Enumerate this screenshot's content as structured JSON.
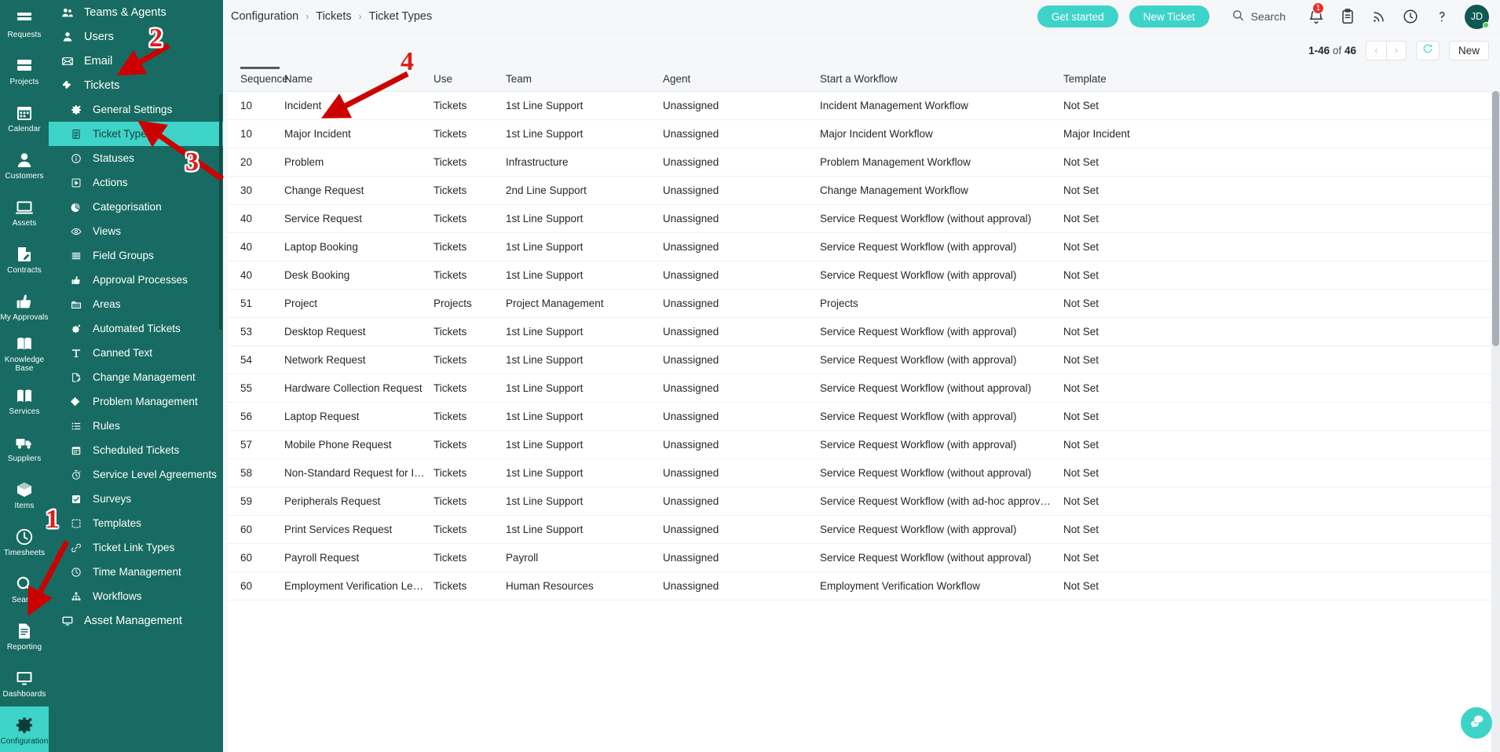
{
  "rail": {
    "items": [
      {
        "label": "Requests",
        "icon": "requests-icon",
        "active": false
      },
      {
        "label": "Projects",
        "icon": "projects-icon",
        "active": false
      },
      {
        "label": "Calendar",
        "icon": "calendar-icon",
        "active": false
      },
      {
        "label": "Customers",
        "icon": "customers-icon",
        "active": false
      },
      {
        "label": "Assets",
        "icon": "assets-icon",
        "active": false
      },
      {
        "label": "Contracts",
        "icon": "contracts-icon",
        "active": false
      },
      {
        "label": "My Approvals",
        "icon": "approvals-icon",
        "active": false
      },
      {
        "label": "Knowledge Base",
        "icon": "knowledge-base-icon",
        "active": false
      },
      {
        "label": "Services",
        "icon": "services-icon",
        "active": false
      },
      {
        "label": "Suppliers",
        "icon": "suppliers-icon",
        "active": false
      },
      {
        "label": "Items",
        "icon": "items-icon",
        "active": false
      },
      {
        "label": "Timesheets",
        "icon": "timesheets-icon",
        "active": false
      },
      {
        "label": "Search",
        "icon": "search-icon",
        "active": false
      },
      {
        "label": "Reporting",
        "icon": "reporting-icon",
        "active": false
      },
      {
        "label": "Dashboards",
        "icon": "dashboards-icon",
        "active": false
      },
      {
        "label": "Configuration",
        "icon": "gear-icon",
        "active": true
      }
    ]
  },
  "confnav": {
    "items": [
      {
        "label": "Teams & Agents",
        "icon": "teams-icon",
        "level": "top",
        "active": false
      },
      {
        "label": "Users",
        "icon": "user-icon",
        "level": "top",
        "active": false
      },
      {
        "label": "Email",
        "icon": "email-icon",
        "level": "top",
        "active": false
      },
      {
        "label": "Tickets",
        "icon": "ticket-icon",
        "level": "top",
        "active": false
      },
      {
        "label": "General Settings",
        "icon": "gear-icon",
        "level": "sub",
        "active": false
      },
      {
        "label": "Ticket Types",
        "icon": "list-doc-icon",
        "level": "sub",
        "active": true
      },
      {
        "label": "Statuses",
        "icon": "info-icon",
        "level": "sub",
        "active": false
      },
      {
        "label": "Actions",
        "icon": "play-box-icon",
        "level": "sub",
        "active": false
      },
      {
        "label": "Categorisation",
        "icon": "pie-icon",
        "level": "sub",
        "active": false
      },
      {
        "label": "Views",
        "icon": "eye-icon",
        "level": "sub",
        "active": false
      },
      {
        "label": "Field Groups",
        "icon": "lines-icon",
        "level": "sub",
        "active": false
      },
      {
        "label": "Approval Processes",
        "icon": "thumbs-up-icon",
        "level": "sub",
        "active": false
      },
      {
        "label": "Areas",
        "icon": "folder-icon",
        "level": "sub",
        "active": false
      },
      {
        "label": "Automated Tickets",
        "icon": "gear-auto-icon",
        "level": "sub",
        "active": false
      },
      {
        "label": "Canned Text",
        "icon": "text-t-icon",
        "level": "sub",
        "active": false
      },
      {
        "label": "Change Management",
        "icon": "edit-doc-icon",
        "level": "sub",
        "active": false
      },
      {
        "label": "Problem Management",
        "icon": "puzzle-icon",
        "level": "sub",
        "active": false
      },
      {
        "label": "Rules",
        "icon": "bullet-list-icon",
        "level": "sub",
        "active": false
      },
      {
        "label": "Scheduled Tickets",
        "icon": "calendar-icon",
        "level": "sub",
        "active": false
      },
      {
        "label": "Service Level Agreements",
        "icon": "stopwatch-icon",
        "level": "sub",
        "active": false
      },
      {
        "label": "Surveys",
        "icon": "checkbox-icon",
        "level": "sub",
        "active": false
      },
      {
        "label": "Templates",
        "icon": "dashed-box-icon",
        "level": "sub",
        "active": false
      },
      {
        "label": "Ticket Link Types",
        "icon": "link-icon",
        "level": "sub",
        "active": false
      },
      {
        "label": "Time Management",
        "icon": "clock-icon",
        "level": "sub",
        "active": false
      },
      {
        "label": "Workflows",
        "icon": "hierarchy-icon",
        "level": "sub",
        "active": false
      },
      {
        "label": "Asset Management",
        "icon": "monitor-icon",
        "level": "top",
        "active": false
      }
    ]
  },
  "header": {
    "breadcrumb": [
      "Configuration",
      "Tickets",
      "Ticket Types"
    ],
    "get_started_label": "Get started",
    "new_ticket_label": "New Ticket",
    "search_label": "Search",
    "notification_count": "1",
    "avatar_initials": "JD"
  },
  "toolbar": {
    "page_info_range": "1-46",
    "page_info_of": "of",
    "page_info_total": "46",
    "prev_label": "‹",
    "next_label": "›",
    "new_label": "New"
  },
  "table": {
    "columns": [
      "Sequence",
      "Name",
      "Use",
      "Team",
      "Agent",
      "Start a Workflow",
      "Template"
    ],
    "rows": [
      [
        "10",
        "Incident",
        "Tickets",
        "1st Line Support",
        "Unassigned",
        "Incident Management Workflow",
        "Not Set"
      ],
      [
        "10",
        "Major Incident",
        "Tickets",
        "1st Line Support",
        "Unassigned",
        "Major Incident Workflow",
        "Major Incident"
      ],
      [
        "20",
        "Problem",
        "Tickets",
        "Infrastructure",
        "Unassigned",
        "Problem Management Workflow",
        "Not Set"
      ],
      [
        "30",
        "Change Request",
        "Tickets",
        "2nd Line Support",
        "Unassigned",
        "Change Management Workflow",
        "Not Set"
      ],
      [
        "40",
        "Service Request",
        "Tickets",
        "1st Line Support",
        "Unassigned",
        "Service Request Workflow (without approval)",
        "Not Set"
      ],
      [
        "40",
        "Laptop Booking",
        "Tickets",
        "1st Line Support",
        "Unassigned",
        "Service Request Workflow (with approval)",
        "Not Set"
      ],
      [
        "40",
        "Desk Booking",
        "Tickets",
        "1st Line Support",
        "Unassigned",
        "Service Request Workflow (with approval)",
        "Not Set"
      ],
      [
        "51",
        "Project",
        "Projects",
        "Project Management",
        "Unassigned",
        "Projects",
        "Not Set"
      ],
      [
        "53",
        "Desktop Request",
        "Tickets",
        "1st Line Support",
        "Unassigned",
        "Service Request Workflow (with approval)",
        "Not Set"
      ],
      [
        "54",
        "Network Request",
        "Tickets",
        "1st Line Support",
        "Unassigned",
        "Service Request Workflow (with approval)",
        "Not Set"
      ],
      [
        "55",
        "Hardware Collection Request",
        "Tickets",
        "1st Line Support",
        "Unassigned",
        "Service Request Workflow (without approval)",
        "Not Set"
      ],
      [
        "56",
        "Laptop Request",
        "Tickets",
        "1st Line Support",
        "Unassigned",
        "Service Request Workflow (with approval)",
        "Not Set"
      ],
      [
        "57",
        "Mobile Phone Request",
        "Tickets",
        "1st Line Support",
        "Unassigned",
        "Service Request Workflow (with approval)",
        "Not Set"
      ],
      [
        "58",
        "Non-Standard Request for IT Hardware",
        "Tickets",
        "1st Line Support",
        "Unassigned",
        "Service Request Workflow (without approval)",
        "Not Set"
      ],
      [
        "59",
        "Peripherals Request",
        "Tickets",
        "1st Line Support",
        "Unassigned",
        "Service Request Workflow (with ad-hoc approval option)",
        "Not Set"
      ],
      [
        "60",
        "Print Services Request",
        "Tickets",
        "1st Line Support",
        "Unassigned",
        "Service Request Workflow (with approval)",
        "Not Set"
      ],
      [
        "60",
        "Payroll Request",
        "Tickets",
        "Payroll",
        "Unassigned",
        "Service Request Workflow (without approval)",
        "Not Set"
      ],
      [
        "60",
        "Employment Verification Letter Request",
        "Tickets",
        "Human Resources",
        "Unassigned",
        "Employment Verification Workflow",
        "Not Set"
      ]
    ]
  },
  "annotations": [
    {
      "number": "1"
    },
    {
      "number": "2"
    },
    {
      "number": "3"
    },
    {
      "number": "4"
    }
  ],
  "colors": {
    "brand_dark": "#176b62",
    "brand_accent": "#3ed3c8",
    "annotation_red": "#cc0000",
    "badge_red": "#e8302a"
  }
}
